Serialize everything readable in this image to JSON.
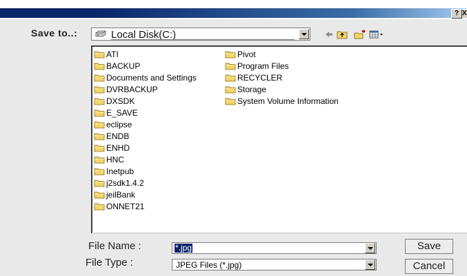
{
  "titlebar": {
    "help_label": "?",
    "close_label": "X"
  },
  "save_to": {
    "label": "Save to..:",
    "location": "Local Disk(C:)"
  },
  "toolbar": {
    "icons": [
      "back-arrow-icon",
      "up-folder-icon",
      "new-folder-icon",
      "view-menu-icon"
    ]
  },
  "folders": {
    "column1": [
      "ATI",
      "BACKUP",
      "Documents and Settings",
      "DVRBACKUP",
      "DXSDK",
      "E_SAVE",
      "eclipse",
      "ENDB",
      "ENHD",
      "HNC",
      "Inetpub",
      "j2sdk1.4.2",
      "jeilBank",
      "ONNET21"
    ],
    "column2": [
      "Pivot",
      "Program Files",
      "RECYCLER",
      "Storage",
      "System Volume Information"
    ]
  },
  "file_name": {
    "label": "File Name :",
    "value": "*.jpg"
  },
  "file_type": {
    "label": "File Type  :",
    "value": "JPEG Files (*.jpg)"
  },
  "buttons": {
    "save": "Save",
    "cancel": "Cancel"
  },
  "colors": {
    "title_gradient_start": "#0a246a",
    "selection": "#0a246a",
    "folder": "#f2d56b"
  }
}
